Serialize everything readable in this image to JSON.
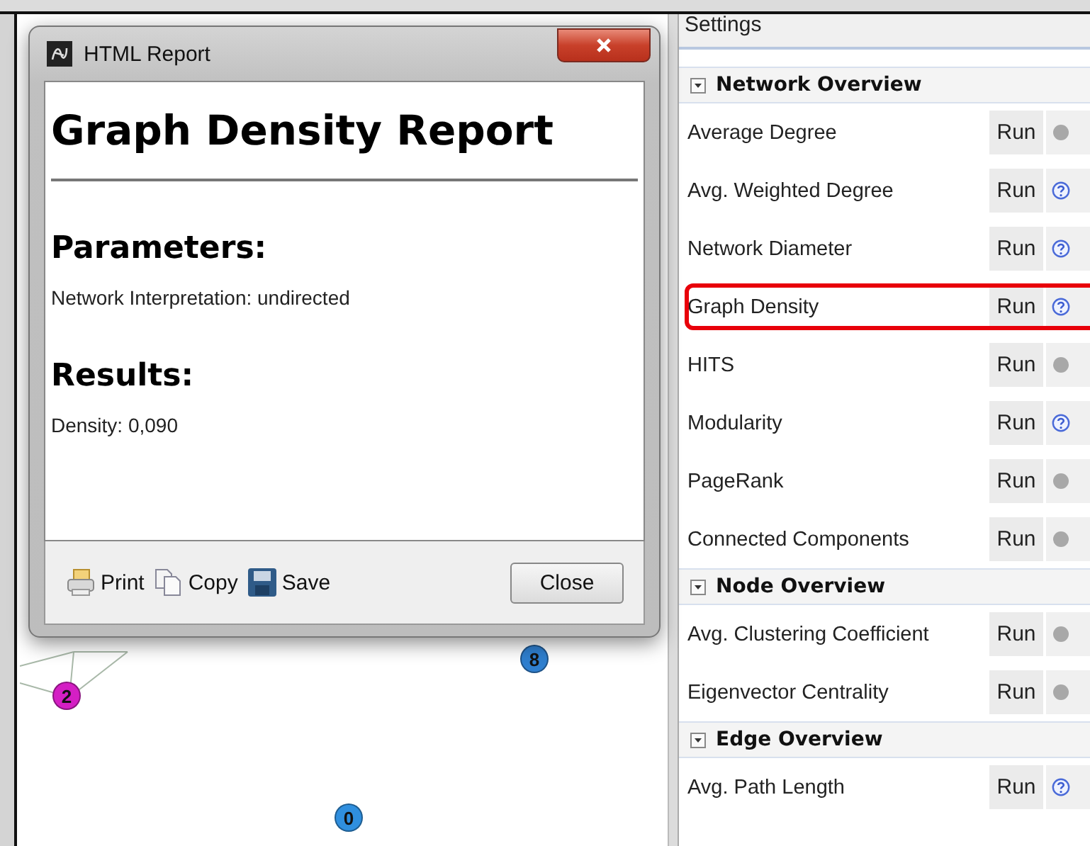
{
  "dialog": {
    "title": "HTML Report",
    "report_title": "Graph Density Report",
    "sections": [
      {
        "heading": "Parameters:",
        "lines": [
          "Network Interpretation: undirected"
        ]
      },
      {
        "heading": "Results:",
        "lines": [
          "Density: 0,090"
        ]
      }
    ],
    "actions": [
      {
        "label": "Print",
        "kind": "print"
      },
      {
        "label": "Copy",
        "kind": "copy"
      },
      {
        "label": "Save",
        "kind": "save"
      }
    ],
    "close_label": "Close"
  },
  "graph": {
    "nodes": [
      {
        "label": "2",
        "color": "#d41fc4"
      },
      {
        "label": "8",
        "color": "#2f7fcf"
      },
      {
        "label": "0",
        "color": "#2f8fdf"
      }
    ]
  },
  "panel": {
    "title": "Settings",
    "groups": [
      {
        "title": "Network Overview",
        "expanded": true,
        "items": [
          {
            "name": "Average Degree",
            "run": "Run",
            "help": false,
            "highlighted": false
          },
          {
            "name": "Avg. Weighted Degree",
            "run": "Run",
            "help": true,
            "highlighted": false
          },
          {
            "name": "Network Diameter",
            "run": "Run",
            "help": true,
            "highlighted": false
          },
          {
            "name": "Graph Density",
            "run": "Run",
            "help": true,
            "highlighted": true
          },
          {
            "name": "HITS",
            "run": "Run",
            "help": false,
            "highlighted": false
          },
          {
            "name": "Modularity",
            "run": "Run",
            "help": true,
            "highlighted": false
          },
          {
            "name": "PageRank",
            "run": "Run",
            "help": false,
            "highlighted": false
          },
          {
            "name": "Connected Components",
            "run": "Run",
            "help": false,
            "highlighted": false
          }
        ]
      },
      {
        "title": "Node Overview",
        "expanded": true,
        "items": [
          {
            "name": "Avg. Clustering Coefficient",
            "run": "Run",
            "help": false,
            "highlighted": false
          },
          {
            "name": "Eigenvector Centrality",
            "run": "Run",
            "help": false,
            "highlighted": false
          }
        ]
      },
      {
        "title": "Edge Overview",
        "expanded": true,
        "items": [
          {
            "name": "Avg. Path Length",
            "run": "Run",
            "help": true,
            "highlighted": false
          }
        ]
      }
    ]
  }
}
